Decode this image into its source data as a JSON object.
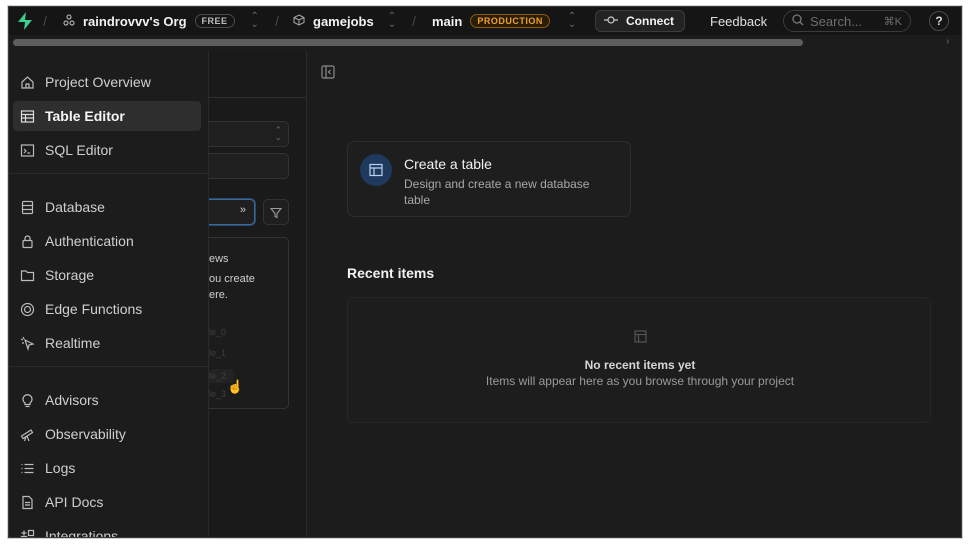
{
  "topbar": {
    "org_name": "raindrovvv's Org",
    "org_plan": "FREE",
    "project_name": "gamejobs",
    "branch_name": "main",
    "branch_env": "PRODUCTION",
    "connect_label": "Connect",
    "feedback_label": "Feedback",
    "search_placeholder": "Search...",
    "search_shortcut": "⌘K",
    "help_label": "?"
  },
  "sidebar": {
    "items": [
      {
        "label": "Project Overview",
        "icon": "home-icon"
      },
      {
        "label": "Table Editor",
        "icon": "table-icon",
        "active": true
      },
      {
        "label": "SQL Editor",
        "icon": "terminal-icon"
      },
      {
        "label": "Database",
        "icon": "database-icon"
      },
      {
        "label": "Authentication",
        "icon": "lock-icon"
      },
      {
        "label": "Storage",
        "icon": "folder-icon"
      },
      {
        "label": "Edge Functions",
        "icon": "functions-icon"
      },
      {
        "label": "Realtime",
        "icon": "realtime-icon"
      },
      {
        "label": "Advisors",
        "icon": "lightbulb-icon"
      },
      {
        "label": "Observability",
        "icon": "telescope-icon"
      },
      {
        "label": "Logs",
        "icon": "list-icon"
      },
      {
        "label": "API Docs",
        "icon": "document-icon"
      },
      {
        "label": "Integrations",
        "icon": "integrations-icon"
      }
    ]
  },
  "midpanel": {
    "fragment_1": "ews",
    "fragment_2": "ou create",
    "fragment_3": "ere.",
    "ghost_rows": [
      "le_0",
      "le_1",
      "le_2",
      "le_3"
    ]
  },
  "main": {
    "card_title": "Create a table",
    "card_desc": "Design and create a new database table",
    "recent_title": "Recent items",
    "recent_empty": "No recent items yet",
    "recent_hint": "Items will appear here as you browse through your project"
  },
  "colors": {
    "accent": "#3ecf8e",
    "production": "#f0a030",
    "card_icon_bg": "#1e3a5f"
  }
}
